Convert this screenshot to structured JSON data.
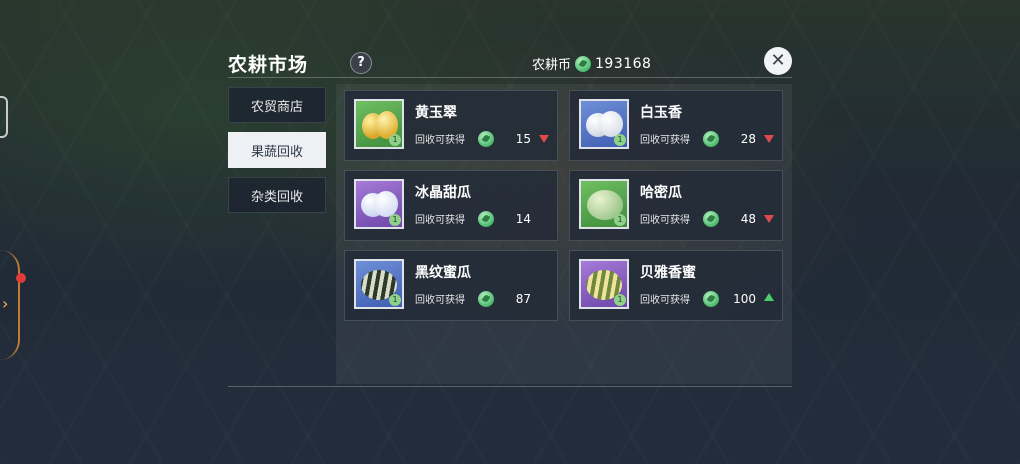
{
  "market": {
    "title": "农耕市场",
    "help_icon": "?",
    "close_icon": "✕",
    "currency": {
      "label": "农耕币",
      "amount": "193168",
      "icon": "leaf-coin-icon"
    }
  },
  "tabs": [
    {
      "label": "农贸商店",
      "active": false
    },
    {
      "label": "果蔬回收",
      "active": true
    },
    {
      "label": "杂类回收",
      "active": false
    }
  ],
  "items": [
    {
      "name": "黄玉翠",
      "reward_label": "回收可获得",
      "reward": "15",
      "trend": "down",
      "thumb_color": "green",
      "fruit": "yellow-melon"
    },
    {
      "name": "白玉香",
      "reward_label": "回收可获得",
      "reward": "28",
      "trend": "down",
      "thumb_color": "blue",
      "fruit": "white-melon"
    },
    {
      "name": "冰晶甜瓜",
      "reward_label": "回收可获得",
      "reward": "14",
      "trend": "none",
      "thumb_color": "purple",
      "fruit": "ice-melon"
    },
    {
      "name": "哈密瓜",
      "reward_label": "回收可获得",
      "reward": "48",
      "trend": "down",
      "thumb_color": "green",
      "fruit": "hami-melon"
    },
    {
      "name": "黑纹蜜瓜",
      "reward_label": "回收可获得",
      "reward": "87",
      "trend": "none",
      "thumb_color": "blue",
      "fruit": "striped-melon"
    },
    {
      "name": "贝雅香蜜",
      "reward_label": "回收可获得",
      "reward": "100",
      "trend": "up",
      "thumb_color": "purple",
      "fruit": "striped-yellow-melon"
    }
  ],
  "colors": {
    "trend_down": "#e04a4a",
    "trend_up": "#4ad06a",
    "active_tab_bg": "#eef0f3"
  }
}
